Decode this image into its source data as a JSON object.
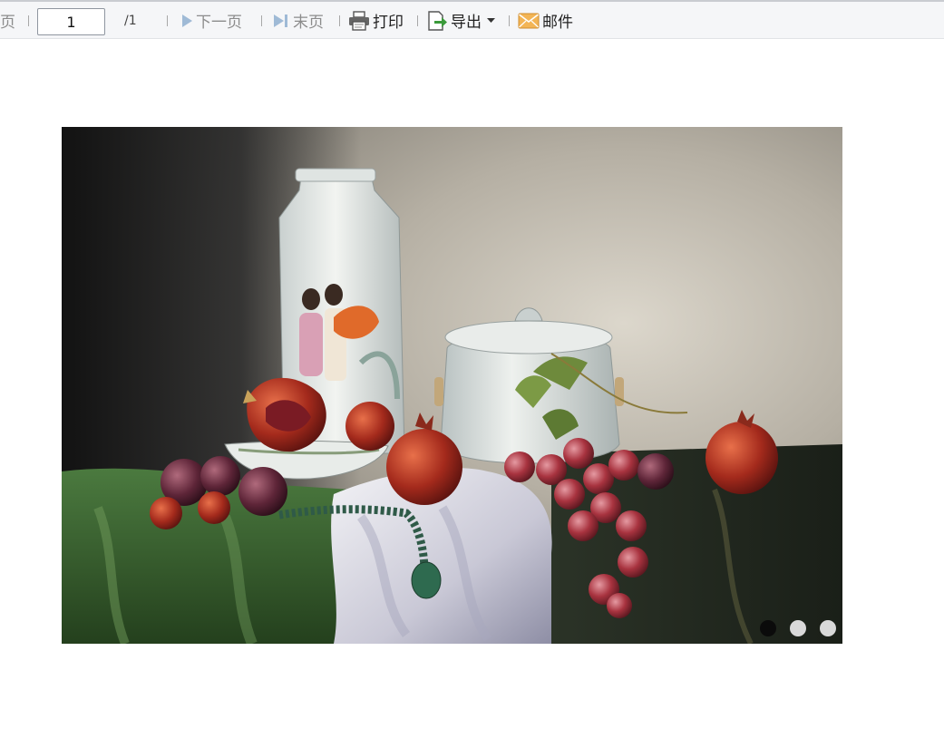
{
  "toolbar": {
    "prev_page_label_partial": "页",
    "page_input_value": "1",
    "total_pages": "/1",
    "next_page_label": "下一页",
    "last_page_label": "末页",
    "print_label": "打印",
    "export_label": "导出",
    "mail_label": "邮件"
  },
  "colors": {
    "toolbar_bg": "#f5f6f8",
    "disabled_text": "#8c8c8c",
    "nav_arrow": "#9fbad6",
    "export_green": "#3a9a3a",
    "mail_orange": "#e8a64a"
  },
  "carousel": {
    "slide_count": 3,
    "active_index": 0,
    "slide_description": "Still-life oil painting: porcelain vase, lidded jar, pomegranates, grapes and plums on draped green and white cloth"
  }
}
